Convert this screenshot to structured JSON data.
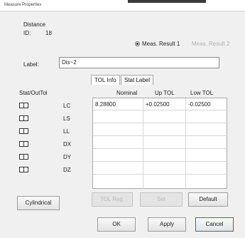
{
  "window": {
    "title": "Measure Properties"
  },
  "distance": {
    "label": "Distance",
    "id_label": "ID:",
    "id_value": "18"
  },
  "result_options": [
    {
      "label": "Meas. Result 1",
      "selected": true,
      "enabled": true
    },
    {
      "label": "Meas. Result 2",
      "selected": false,
      "enabled": false
    }
  ],
  "label_field": {
    "label": "Label:",
    "value": "Dis~2"
  },
  "tabs": [
    {
      "label": "TOL Info",
      "active": true
    },
    {
      "label": "Stat Label",
      "active": false
    }
  ],
  "stat_header": "Stat/OutTol",
  "columns": [
    "Nominal",
    "Up TOL",
    "Low TOL"
  ],
  "rows": [
    {
      "name": "LC",
      "nominal": "8.28800",
      "up_tol": "+0.02500",
      "low_tol": "-0.02500"
    },
    {
      "name": "LS",
      "nominal": "",
      "up_tol": "",
      "low_tol": ""
    },
    {
      "name": "LL",
      "nominal": "",
      "up_tol": "",
      "low_tol": ""
    },
    {
      "name": "DX",
      "nominal": "",
      "up_tol": "",
      "low_tol": ""
    },
    {
      "name": "DY",
      "nominal": "",
      "up_tol": "",
      "low_tol": ""
    },
    {
      "name": "DZ",
      "nominal": "",
      "up_tol": "",
      "low_tol": ""
    }
  ],
  "buttons": {
    "cylindrical": "Cylindrical",
    "tol_reg": "TOL Reg.",
    "set": "Set",
    "default": "Default",
    "ok": "OK",
    "apply": "Apply",
    "cancel": "Cancel"
  }
}
